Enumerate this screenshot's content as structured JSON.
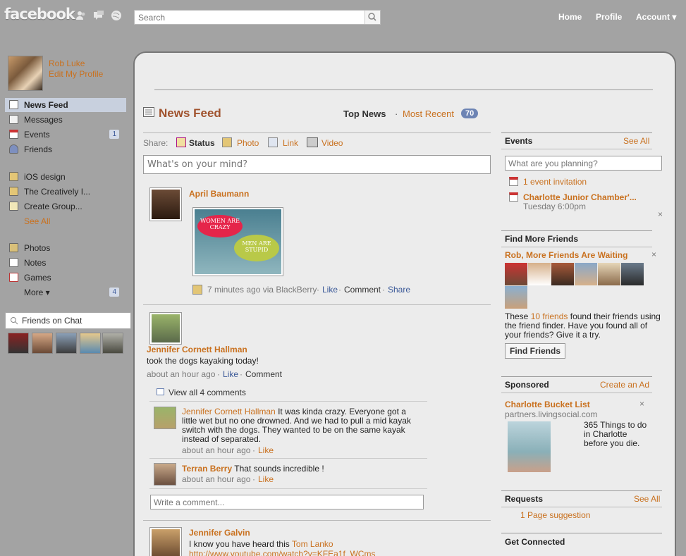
{
  "topbar": {
    "logo": "facebook",
    "search_placeholder": "Search",
    "links": [
      "Home",
      "Profile",
      "Account ▾"
    ],
    "icons": [
      "friend-requests-icon",
      "messages-icon",
      "notifications-icon"
    ]
  },
  "profile": {
    "name": "Rob Luke",
    "edit_label": "Edit My Profile"
  },
  "sidebar": {
    "items": [
      {
        "label": "News Feed",
        "count": ""
      },
      {
        "label": "Messages",
        "count": ""
      },
      {
        "label": "Events",
        "count": "1"
      },
      {
        "label": "Friends",
        "count": ""
      }
    ],
    "groups": [
      {
        "label": "iOS design"
      },
      {
        "label": "The Creatively I..."
      },
      {
        "label": "Create Group..."
      }
    ],
    "see_all": "See All",
    "apps": [
      {
        "label": "Photos",
        "count": ""
      },
      {
        "label": "Notes",
        "count": ""
      },
      {
        "label": "Games",
        "count": ""
      }
    ],
    "more": {
      "label": "More ▾",
      "count": "4"
    },
    "chat_label": "Friends on Chat"
  },
  "feed": {
    "title": "News Feed",
    "top_news": "Top News",
    "separator": "·",
    "most_recent": "Most Recent",
    "most_recent_count": "70",
    "share_label": "Share:",
    "share_options": [
      "Status",
      "Photo",
      "Link",
      "Video"
    ],
    "status_placeholder": "What's on your mind?",
    "posts": [
      {
        "author": "April Baumann",
        "photo_text_1": "WOMEN ARE CRAZY",
        "photo_text_2": "MEN ARE STUPID",
        "meta": "7 minutes ago via BlackBerry",
        "actions": [
          "Like",
          "Comment",
          "Share"
        ]
      },
      {
        "author": "Jennifer Cornett Hallman",
        "text": "took the dogs kayaking today!",
        "meta": "about an hour ago",
        "actions": [
          "Like",
          "Comment"
        ],
        "view_comments": "View all 4 comments",
        "comments": [
          {
            "author": "Jennifer Cornett Hallman",
            "text": "It was kinda crazy. Everyone got a little wet but no one drowned. And we had to pull a mid kayak switch with the dogs. They wanted to be on the same kayak instead of separated.",
            "meta": "about an hour ago",
            "like": "Like"
          },
          {
            "author": "Terran Berry",
            "text": "That sounds incredible !",
            "meta": "about an hour ago",
            "like": "Like"
          }
        ],
        "comment_placeholder": "Write a comment..."
      },
      {
        "author": "Jennifer Galvin",
        "text": "I know you have heard this",
        "mention": "Tom Lanko",
        "link": "http://www.youtube.com/watch?v=KFEa1f_WCms"
      }
    ]
  },
  "right": {
    "events": {
      "title": "Events",
      "see_all": "See All",
      "placeholder": "What are you planning?",
      "invitation": "1 event invitation",
      "event_name": "Charlotte Junior Chamber'...",
      "event_time": "Tuesday 6:00pm"
    },
    "find_friends": {
      "title": "Find More Friends",
      "subtitle": "Rob, More Friends Are Waiting",
      "text_before": "These",
      "count_link": "10 friends",
      "text_after": "found their friends using the friend finder. Have you found all of your friends? Give it a try.",
      "button": "Find Friends"
    },
    "sponsored": {
      "title": "Sponsored",
      "create_ad": "Create an Ad",
      "ad_title": "Charlotte Bucket List",
      "ad_domain": "partners.livingsocial.com",
      "ad_text": "365 Things to do in Charlotte before you die."
    },
    "requests": {
      "title": "Requests",
      "see_all": "See All",
      "item": "1 Page suggestion"
    },
    "connected": {
      "title": "Get Connected"
    }
  },
  "colors": {
    "accent": "#c9711f",
    "link_blue": "#3b5998",
    "background": "#a3a3a3",
    "panel": "#ececec"
  }
}
